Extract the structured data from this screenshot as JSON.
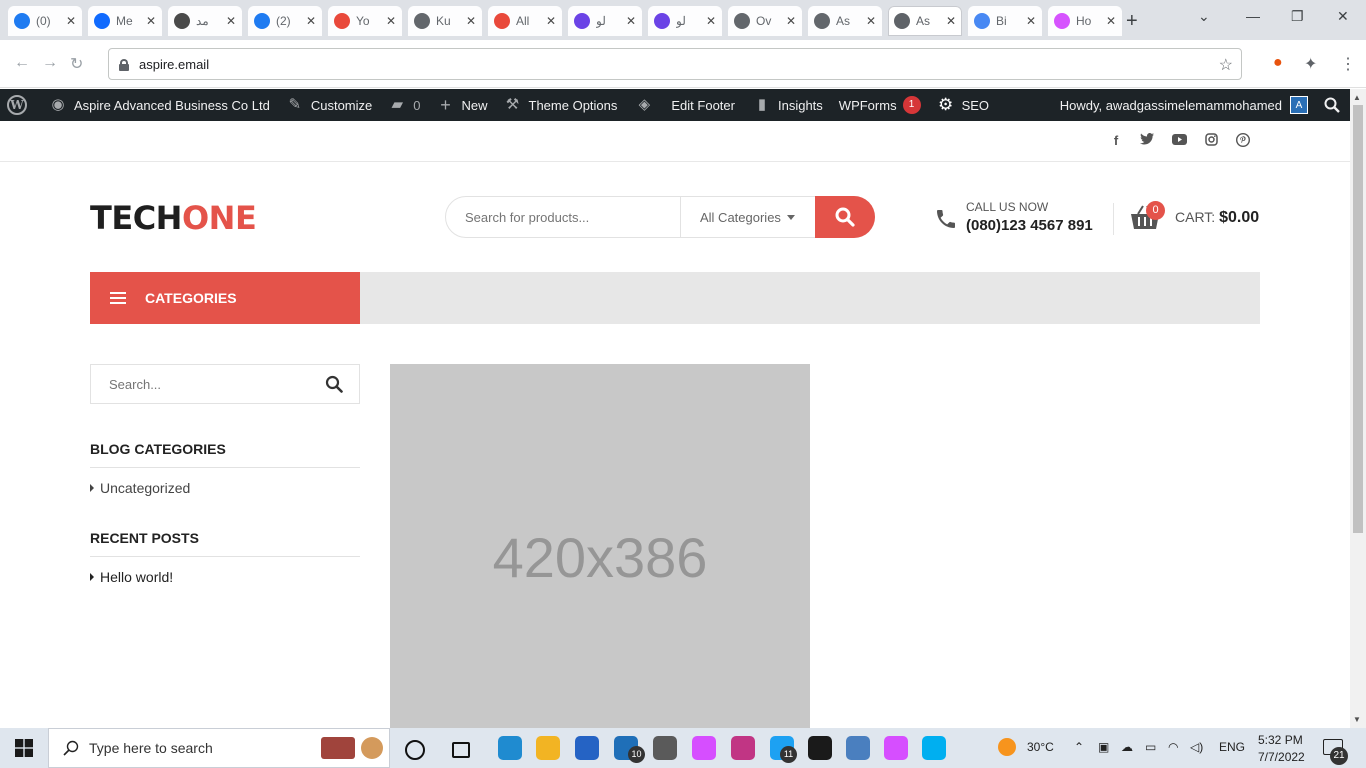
{
  "browser": {
    "tabs": [
      {
        "title": "(0)",
        "icon": "facebook-icon",
        "color": "#1877f2"
      },
      {
        "title": "Me",
        "icon": "meta-icon",
        "color": "#0866ff"
      },
      {
        "title": "مد",
        "icon": "calendar-icon",
        "color": "#444444"
      },
      {
        "title": "(2)",
        "icon": "facebook-icon",
        "color": "#1877f2"
      },
      {
        "title": "Yo",
        "icon": "gmail-icon",
        "color": "#ea4335"
      },
      {
        "title": "Ku",
        "icon": "globe-icon",
        "color": "#5f6368"
      },
      {
        "title": "All",
        "icon": "gmail-icon",
        "color": "#ea4335"
      },
      {
        "title": "لو",
        "icon": "hostinger-icon",
        "color": "#673de6"
      },
      {
        "title": "لو",
        "icon": "hostinger-icon",
        "color": "#673de6"
      },
      {
        "title": "Ov",
        "icon": "globe-icon",
        "color": "#5f6368"
      },
      {
        "title": "As",
        "icon": "globe-icon",
        "color": "#5f6368"
      },
      {
        "title": "As",
        "icon": "globe-icon",
        "color": "#5f6368",
        "active": true
      },
      {
        "title": "Bi",
        "icon": "translate-icon",
        "color": "#4285f4"
      },
      {
        "title": "Ho",
        "icon": "hotjar-icon",
        "color": "#d64eff"
      }
    ],
    "url": "aspire.email"
  },
  "adminbar": {
    "site_name": "Aspire Advanced Business Co Ltd",
    "customize": "Customize",
    "comments_count": "0",
    "new": "New",
    "theme_options": "Theme Options",
    "edit_footer": "Edit Footer",
    "insights": "Insights",
    "wpforms": "WPForms",
    "wpforms_badge": "1",
    "seo": "SEO",
    "howdy": "Howdy, awadgassimelemammohamed",
    "avatar_letter": "A"
  },
  "header": {
    "logo_part1": "TECH",
    "logo_part2": "ONE",
    "search_placeholder": "Search for products...",
    "category_select": "All Categories",
    "call_label": "CALL US NOW",
    "call_number": "(080)123 4567 891",
    "cart_count": "0",
    "cart_label": "CART:",
    "cart_total": "$0.00",
    "categories_label": "CATEGORIES"
  },
  "sidebar": {
    "search_placeholder": "Search...",
    "blog_categories_title": "BLOG CATEGORIES",
    "blog_categories": [
      "Uncategorized"
    ],
    "recent_posts_title": "RECENT POSTS",
    "recent_posts": [
      "Hello world!"
    ]
  },
  "main": {
    "placeholder_text": "420x386"
  },
  "taskbar": {
    "search_placeholder": "Type here to search",
    "mail_badge": "10",
    "twitter_badge": "11",
    "temperature": "30°C",
    "language": "ENG",
    "time": "5:32 PM",
    "date": "7/7/2022",
    "notification_count": "21"
  },
  "colors": {
    "accent": "#e4534a",
    "adminbar": "#1d2327"
  }
}
